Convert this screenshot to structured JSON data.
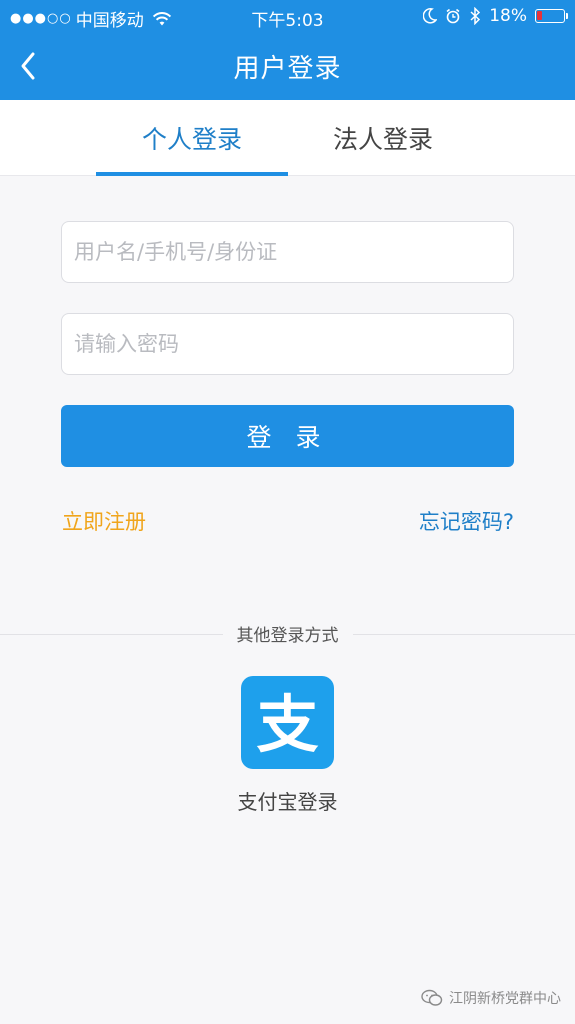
{
  "status_bar": {
    "signal_dots": "●●●○○",
    "carrier": "中国移动",
    "time": "下午5:03",
    "battery": "18%",
    "battery_level": 0.18,
    "icons": [
      "wifi-icon",
      "moon-icon",
      "alarm-icon",
      "bluetooth-icon",
      "battery-icon"
    ]
  },
  "header": {
    "title": "用户登录",
    "back_icon": "chevron-left-icon"
  },
  "tabs": [
    {
      "label": "个人登录",
      "active": true
    },
    {
      "label": "法人登录",
      "active": false
    }
  ],
  "form": {
    "username_placeholder": "用户名/手机号/身份证",
    "username_value": "",
    "password_placeholder": "请输入密码",
    "password_value": "",
    "login_label": "登 录",
    "register_label": "立即注册",
    "forgot_label": "忘记密码?"
  },
  "other_login": {
    "label": "其他登录方式",
    "alipay_label": "支付宝登录",
    "alipay_glyph": "支",
    "alipay_icon": "alipay-icon"
  },
  "watermark": {
    "text": "江阴新桥党群中心",
    "icon": "wechat-icon"
  },
  "colors": {
    "primary": "#1f8fe3",
    "register_link": "#f0a51c",
    "battery_low": "#e8323a"
  }
}
